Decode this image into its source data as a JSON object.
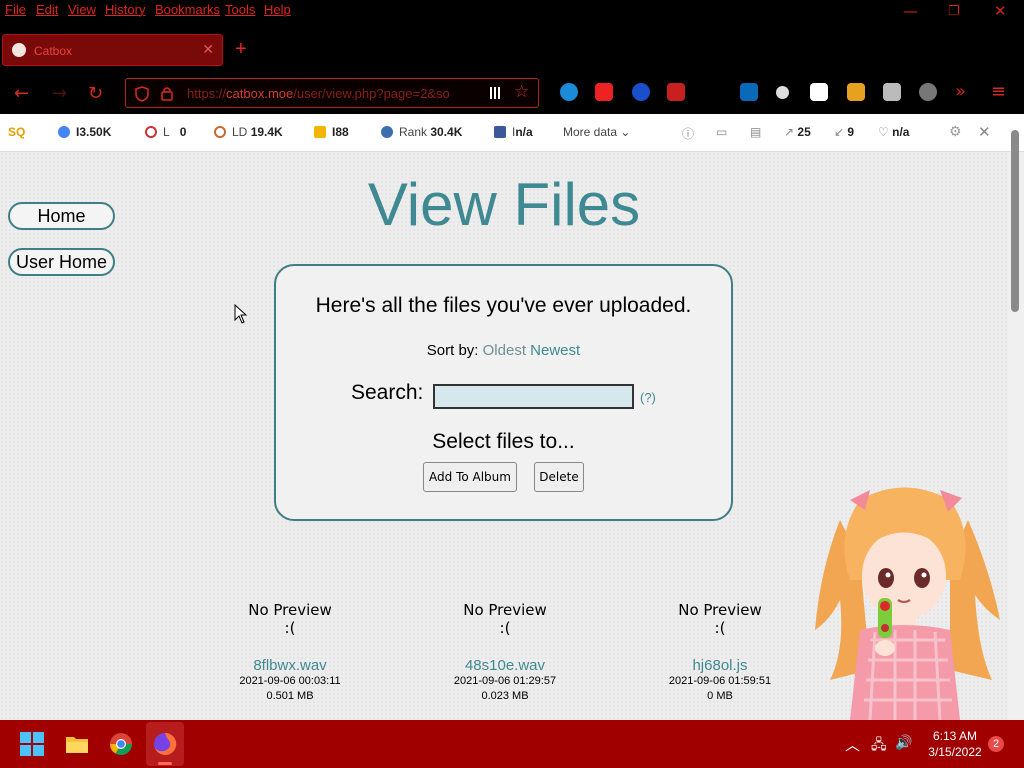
{
  "menubar": {
    "items": [
      "File",
      "Edit",
      "View",
      "History",
      "Bookmarks",
      "Tools",
      "Help"
    ]
  },
  "tab": {
    "title": "Catbox"
  },
  "navbar": {
    "url_prefix": "https://",
    "url_domain": "catbox.moe",
    "url_path": "/user/view.php?page=2&so"
  },
  "seo": {
    "google": "I3.50K",
    "l": "L",
    "l_value": "0",
    "ld": "LD",
    "ld_value": "19.4K",
    "bing": "I88",
    "rank_label": "Rank",
    "rank_value": "30.4K",
    "fb": "I",
    "fb_value": "n/a",
    "more": "More data",
    "links_out": "25",
    "links_in": "9",
    "trust": "n/a"
  },
  "sidebar": {
    "home": "Home",
    "user_home": "User Home"
  },
  "page": {
    "title": "View Files",
    "intro": "Here's all the files you've ever uploaded.",
    "sort_label": "Sort by:",
    "sort_oldest": "Oldest",
    "sort_newest": "Newest",
    "search_label": "Search:",
    "search_value": "",
    "help": "(?)",
    "select_label": "Select files to...",
    "add_album": "Add To Album",
    "delete": "Delete"
  },
  "files": [
    {
      "preview": "No Preview",
      "sad": ":(",
      "name": "8flbwx.wav",
      "date": "2021-09-06 00:03:11",
      "size": "0.501 MB"
    },
    {
      "preview": "No Preview",
      "sad": ":(",
      "name": "48s10e.wav",
      "date": "2021-09-06 01:29:57",
      "size": "0.023 MB"
    },
    {
      "preview": "No Preview",
      "sad": ":(",
      "name": "hj68ol.js",
      "date": "2021-09-06 01:59:51",
      "size": "0 MB"
    }
  ],
  "taskbar": {
    "time": "6:13 AM",
    "date": "3/15/2022",
    "notifications": "2"
  },
  "colors": {
    "accent": "#3f8a92",
    "browser_red": "#e0241b",
    "taskbar": "#a00000"
  }
}
